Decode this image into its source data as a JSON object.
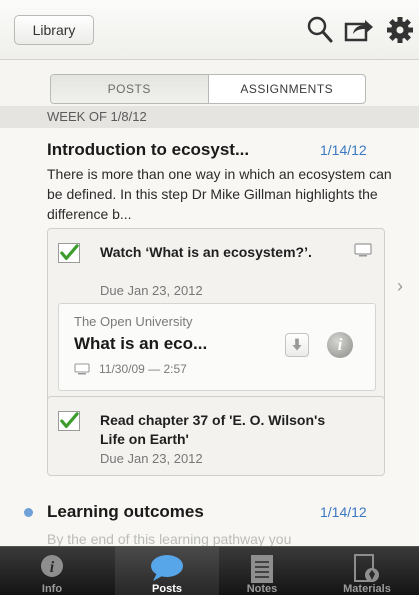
{
  "header": {
    "library_label": "Library",
    "icons": [
      "search-icon",
      "share-icon",
      "gear-icon"
    ]
  },
  "segmented": {
    "tabs": [
      {
        "label": "POSTS",
        "selected": true
      },
      {
        "label": "ASSIGNMENTS",
        "selected": false
      }
    ]
  },
  "feed": {
    "week_header": "WEEK OF 1/8/12",
    "posts": [
      {
        "title": "Introduction to ecosyst...",
        "date": "1/14/12",
        "body": "There is more than one way in which an ecosystem can be defined. In this step Dr Mike Gillman highlights the difference b...",
        "tasks": [
          {
            "title": "Watch ‘What is an ecosystem?’.",
            "due": "Due Jan 23, 2012",
            "checked": true,
            "resource": {
              "publisher": "The Open University",
              "title": "What is an eco...",
              "meta": "11/30/09 — 2:57"
            }
          },
          {
            "title": "Read chapter 37 of 'E. O. Wilson's Life on Earth'",
            "due": "Due Jan 23, 2012",
            "checked": true
          }
        ]
      },
      {
        "title": "Learning outcomes",
        "date": "1/14/12",
        "body": "By the end of this learning pathway you"
      }
    ]
  },
  "tabbar": {
    "tabs": [
      {
        "label": "Info",
        "icon": "info-icon",
        "selected": false
      },
      {
        "label": "Posts",
        "icon": "speech-bubble-icon",
        "selected": true
      },
      {
        "label": "Notes",
        "icon": "notes-icon",
        "selected": false
      },
      {
        "label": "Materials",
        "icon": "materials-icon",
        "selected": false
      }
    ]
  },
  "colors": {
    "accent_date": "#3a78c3",
    "check_green": "#3c9c2c",
    "tabbar_dark": "#1e1e1e"
  }
}
